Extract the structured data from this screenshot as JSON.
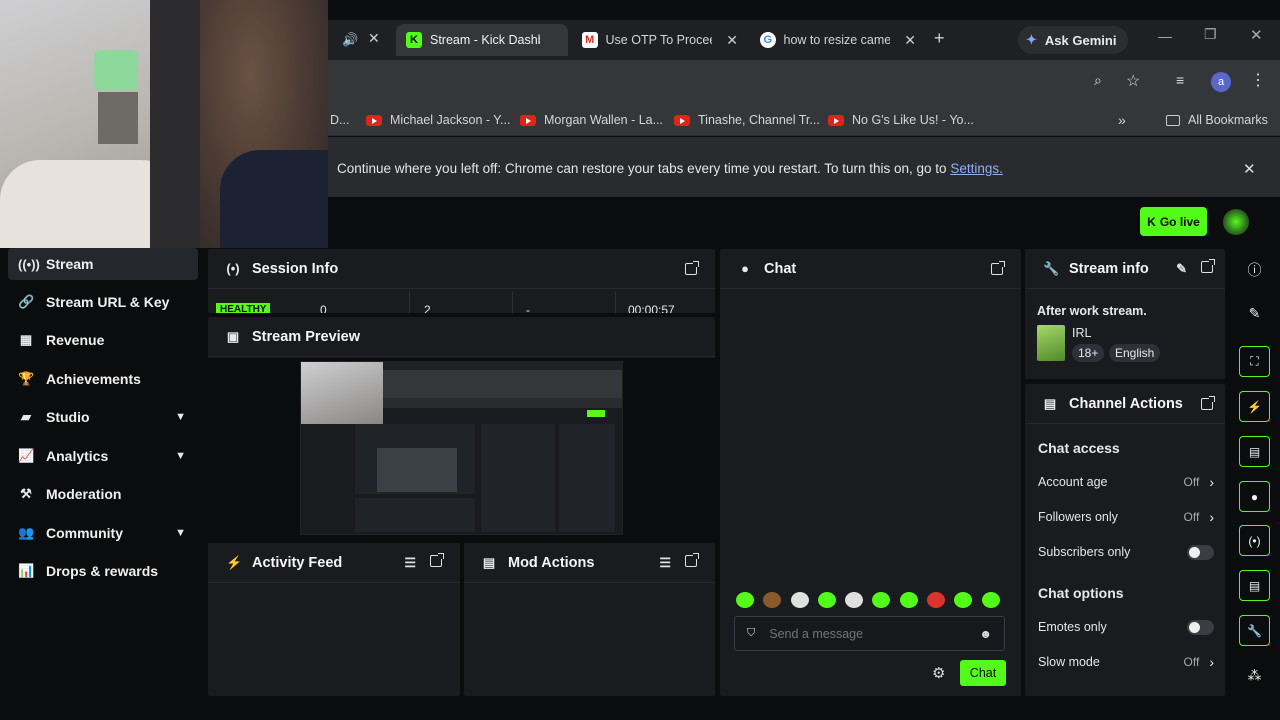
{
  "browser": {
    "tabs": [
      {
        "title": "Stream - Kick Dashb",
        "favicon": "K"
      },
      {
        "title": "Use OTP To Proceed",
        "favicon": "M"
      },
      {
        "title": "how to resize came",
        "favicon": "G"
      }
    ],
    "ask_gemini": "Ask Gemini",
    "profile_initial": "a",
    "bookmarks": [
      {
        "label": "D..."
      },
      {
        "label": "Michael Jackson - Y..."
      },
      {
        "label": "Morgan Wallen - La..."
      },
      {
        "label": "Tinashe, Channel Tr..."
      },
      {
        "label": "No G's Like Us! - Yo..."
      }
    ],
    "all_bookmarks": "All Bookmarks",
    "infobar_text": "Continue where you left off: Chrome can restore your tabs every time you restart. To turn this on, go to",
    "infobar_link": "Settings."
  },
  "header": {
    "go_live": "Go live"
  },
  "nav": {
    "items": [
      {
        "label": "Stream",
        "icon": "broadcast-icon"
      },
      {
        "label": "Stream URL & Key",
        "icon": "link-icon"
      },
      {
        "label": "Revenue",
        "icon": "revenue-icon"
      },
      {
        "label": "Achievements",
        "icon": "trophy-icon"
      },
      {
        "label": "Studio",
        "icon": "studio-icon"
      },
      {
        "label": "Analytics",
        "icon": "analytics-icon"
      },
      {
        "label": "Moderation",
        "icon": "gavel-icon"
      },
      {
        "label": "Community",
        "icon": "community-icon"
      },
      {
        "label": "Drops & rewards",
        "icon": "drops-icon"
      }
    ]
  },
  "session": {
    "title": "Session Info",
    "status": "HEALTHY",
    "values": [
      "0",
      "2",
      "-",
      "00:00:57"
    ]
  },
  "preview": {
    "title": "Stream Preview"
  },
  "activity": {
    "title": "Activity Feed"
  },
  "mod": {
    "title": "Mod Actions"
  },
  "chat": {
    "title": "Chat",
    "placeholder": "Send a message",
    "send_label": "Chat"
  },
  "stream_info": {
    "title": "Stream info",
    "stream_title": "After work stream.",
    "category": "IRL",
    "badges": [
      "18+",
      "English"
    ]
  },
  "channel_actions": {
    "title": "Channel Actions",
    "chat_access_heading": "Chat access",
    "account_age": {
      "label": "Account age",
      "value": "Off"
    },
    "followers_only": {
      "label": "Followers only",
      "value": "Off"
    },
    "subscribers_only": {
      "label": "Subscribers only"
    },
    "chat_options_heading": "Chat options",
    "emotes_only": {
      "label": "Emotes only"
    },
    "slow_mode": {
      "label": "Slow mode",
      "value": "Off"
    }
  },
  "colors": {
    "accent": "#53fc18",
    "panel": "#191b1f",
    "bg": "#0b0c0d"
  }
}
